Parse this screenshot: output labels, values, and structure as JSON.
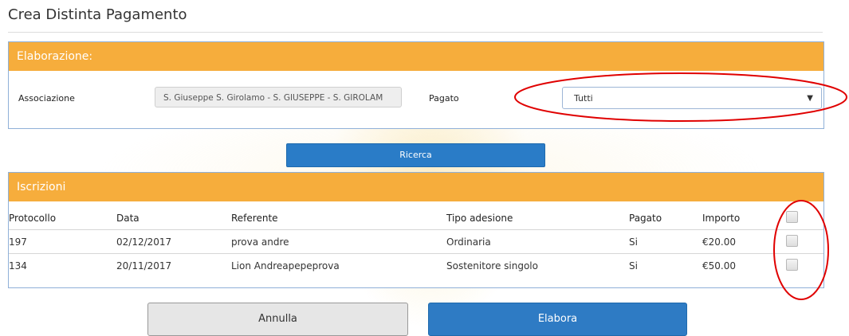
{
  "page": {
    "title": "Crea Distinta Pagamento"
  },
  "elaborazione": {
    "header": "Elaborazione:",
    "associazione_label": "Associazione",
    "associazione_value": "S. Giuseppe S. Girolamo - S. GIUSEPPE - S. GIROLAM",
    "pagato_label": "Pagato",
    "pagato_selected": "Tutti"
  },
  "ricerca_label": "Ricerca",
  "iscrizioni": {
    "header": "Iscrizioni",
    "columns": [
      "Protocollo",
      "Data",
      "Referente",
      "Tipo adesione",
      "Pagato",
      "Importo"
    ],
    "rows": [
      {
        "protocollo": "197",
        "data": "02/12/2017",
        "referente": "prova andre",
        "tipo": "Ordinaria",
        "pagato": "Si",
        "importo": "€20.00"
      },
      {
        "protocollo": "134",
        "data": "20/11/2017",
        "referente": "Lion Andreapepeprova",
        "tipo": "Sostenitore singolo",
        "pagato": "Si",
        "importo": "€50.00"
      }
    ]
  },
  "buttons": {
    "annulla": "Annulla",
    "elabora": "Elabora"
  },
  "colors": {
    "panel_header": "#f6ad3c",
    "primary_button": "#2e7bc4",
    "annotation": "#e00000"
  }
}
